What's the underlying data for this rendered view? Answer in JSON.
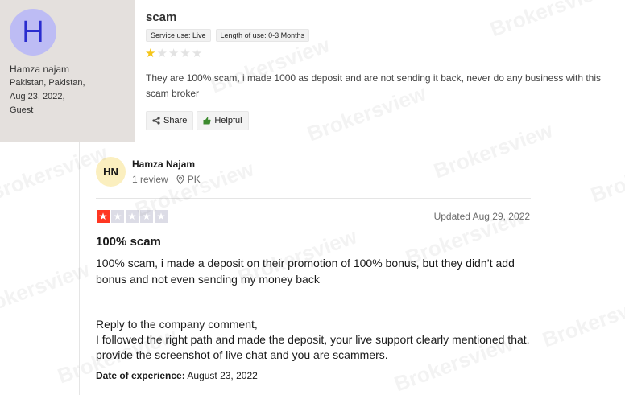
{
  "top_review": {
    "avatar_letter": "H",
    "author": "Hamza najam",
    "location_line1": "Pakistan, Pakistan,",
    "date": "Aug 23, 2022,",
    "role": "Guest",
    "title": "scam",
    "tags": [
      "Service use: Live",
      "Length of use: 0-3 Months"
    ],
    "rating": 1,
    "rating_max": 5,
    "body": "They are 100% scam, i made 1000 as deposit and are not sending it back, never do any business with this scam broker",
    "share_label": "Share",
    "helpful_label": "Helpful"
  },
  "bottom_review": {
    "avatar_initials": "HN",
    "author": "Hamza Najam",
    "review_count": "1 review",
    "country": "PK",
    "rating": 1,
    "rating_max": 5,
    "updated": "Updated Aug 29, 2022",
    "title": "100% scam",
    "text": "100% scam, i made a deposit on their promotion of 100% bonus, but they didn’t add bonus and not even sending my money back",
    "reply_line1": "Reply to the company comment,",
    "reply_body": "I followed the right path and made the deposit, your live support clearly mentioned that, provide the screenshot of live chat and you are scammers.",
    "date_of_experience_label": "Date of experience:",
    "date_of_experience": "August 23, 2022"
  },
  "watermark": "Brokersview",
  "colors": {
    "star_gold": "#f5c518",
    "trustpilot_red": "#ff3722",
    "avatar_purple_bg": "#bdbcf4",
    "avatar_yellow_bg": "#fbefbf"
  }
}
